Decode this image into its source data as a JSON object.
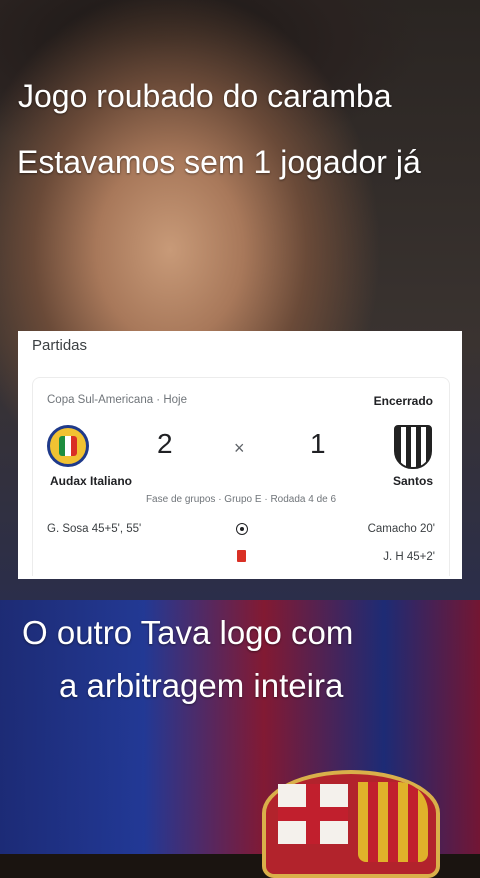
{
  "captions": {
    "line1": "Jogo roubado do caramba",
    "line2": "Estavamos sem 1 jogador já",
    "line3": "O outro Tava logo com",
    "line4": "a arbitragem inteira"
  },
  "card": {
    "title": "Partidas",
    "competition": "Copa Sul-Americana · Hoje",
    "status": "Encerrado",
    "home": {
      "name": "Audax Italiano",
      "score": "2",
      "logo_icon": "audax-crest-icon"
    },
    "away": {
      "name": "Santos",
      "score": "1",
      "logo_icon": "santos-crest-icon"
    },
    "separator": "×",
    "stage": "Fase de grupos · Grupo E · Rodada 4 de 6",
    "events": {
      "home_goals": "G. Sosa 45+5', 55'",
      "away_goals": "Camacho 20'",
      "away_red_card": "J. H 45+2'"
    }
  },
  "colors": {
    "red_card": "#d93025",
    "status_text": "#202124",
    "muted_text": "#70757a"
  }
}
